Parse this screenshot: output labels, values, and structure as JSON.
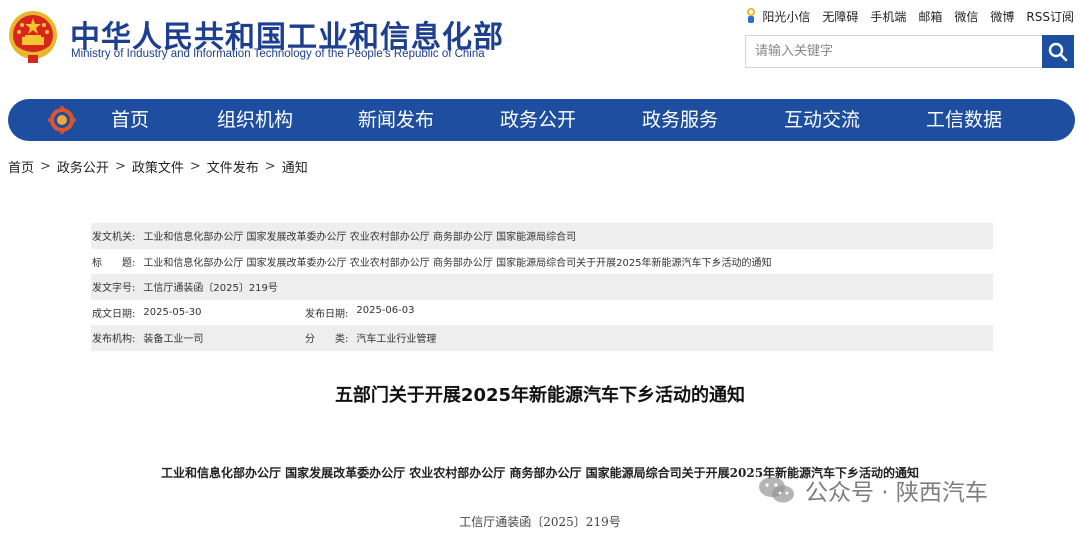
{
  "header": {
    "title_cn": "中华人民共和国工业和信息化部",
    "title_en": "Ministry of Industry and Information Technology of the People's Republic of China",
    "top_links": [
      "阳光小信",
      "无障碍",
      "手机端",
      "邮箱",
      "微信",
      "微博",
      "RSS订阅"
    ],
    "search_placeholder": "请输入关键字",
    "icons": {
      "emblem": "national-emblem-icon",
      "search": "search-icon",
      "sun": "sunshine-mascot-icon",
      "nav_logo": "ministry-logo-icon"
    }
  },
  "nav": {
    "items": [
      "首页",
      "组织机构",
      "新闻发布",
      "政务公开",
      "政务服务",
      "互动交流",
      "工信数据"
    ]
  },
  "breadcrumb": [
    "首页",
    "政务公开",
    "政策文件",
    "文件发布",
    "通知"
  ],
  "breadcrumb_sep": ">",
  "meta": {
    "issuer_label": "发文机关:",
    "issuer_value": "工业和信息化部办公厅 国家发展改革委办公厅 农业农村部办公厅 商务部办公厅 国家能源局综合司",
    "title_label": "标　　题:",
    "title_value": "工业和信息化部办公厅 国家发展改革委办公厅 农业农村部办公厅 商务部办公厅 国家能源局综合司关于开展2025年新能源汽车下乡活动的通知",
    "docno_label": "发文字号:",
    "docno_value": "工信厅通装函〔2025〕219号",
    "date_written_label": "成文日期:",
    "date_written_value": "2025-05-30",
    "date_pub_label": "发布日期:",
    "date_pub_value": "2025-06-03",
    "org_label": "发布机构:",
    "org_value": "装备工业一司",
    "cat_label": "分　　类:",
    "cat_value": "汽车工业行业管理"
  },
  "article": {
    "title": "五部门关于开展2025年新能源汽车下乡活动的通知",
    "subtitle": "工业和信息化部办公厅 国家发展改革委办公厅 农业农村部办公厅 商务部办公厅 国家能源局综合司关于开展2025年新能源汽车下乡活动的通知",
    "doc_number": "工信厅通装函〔2025〕219号"
  },
  "watermark": {
    "text": "公众号 · 陕西汽车",
    "icon": "wechat-icon"
  },
  "colors": {
    "brand_blue": "#1e4ea0",
    "emblem_red": "#d7261e",
    "emblem_gold": "#f3c531"
  }
}
